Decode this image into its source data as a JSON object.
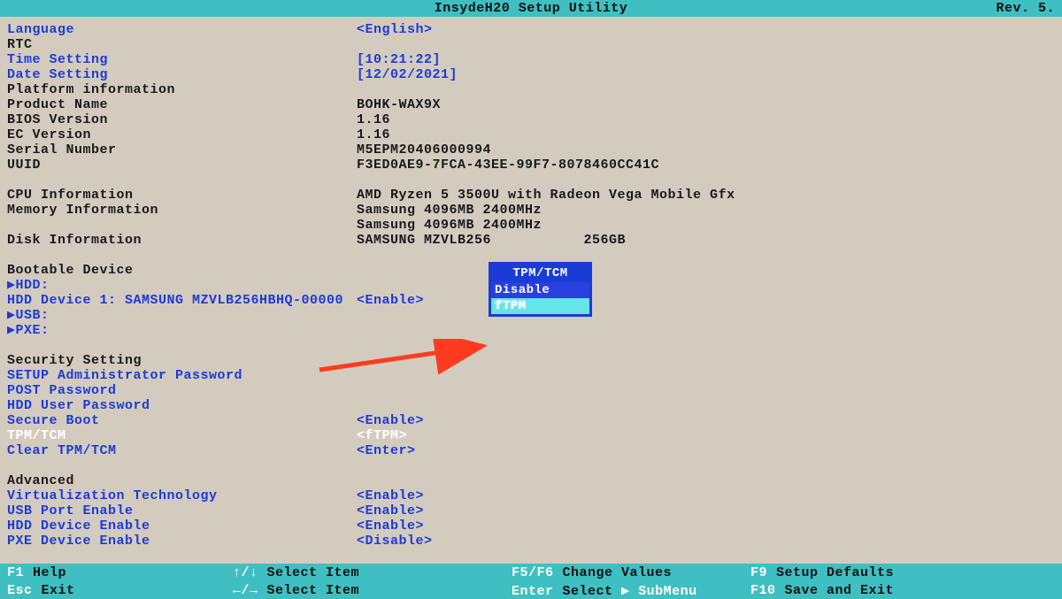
{
  "titlebar": {
    "title": "InsydeH20 Setup Utility",
    "rev": "Rev. 5."
  },
  "rows": {
    "language": {
      "label": "Language",
      "value": "<English>"
    },
    "rtc": {
      "label": "RTC",
      "value": ""
    },
    "time": {
      "label": "Time Setting",
      "value": "[10:21:22]"
    },
    "date": {
      "label": "Date Setting",
      "value": "[12/02/2021]"
    },
    "platform_header": {
      "label": "Platform information",
      "value": ""
    },
    "product": {
      "label": "Product Name",
      "value": "BOHK-WAX9X"
    },
    "bios": {
      "label": "BIOS Version",
      "value": "1.16"
    },
    "ec": {
      "label": "EC Version",
      "value": "1.16"
    },
    "serial": {
      "label": "Serial Number",
      "value": "M5EPM20406000994"
    },
    "uuid": {
      "label": "UUID",
      "value": "F3ED0AE9-7FCA-43EE-99F7-8078460CC41C"
    },
    "cpu": {
      "label": "CPU Information",
      "value": "AMD Ryzen 5 3500U with Radeon Vega Mobile Gfx"
    },
    "mem1": {
      "label": "Memory Information",
      "value": "Samsung 4096MB 2400MHz"
    },
    "mem2": {
      "label": "",
      "value": "Samsung 4096MB 2400MHz"
    },
    "disk": {
      "label": "Disk Information",
      "value": "SAMSUNG MZVLB256           256GB"
    },
    "boot_header": {
      "label": "Bootable Device",
      "value": ""
    },
    "hdd": {
      "label": "▶HDD:",
      "value": ""
    },
    "hdd1": {
      "label": "HDD Device 1: SAMSUNG MZVLB256HBHQ-00000",
      "value": "<Enable>"
    },
    "usb": {
      "label": "▶USB:",
      "value": ""
    },
    "pxe": {
      "label": "▶PXE:",
      "value": ""
    },
    "sec_header": {
      "label": "Security Setting",
      "value": ""
    },
    "setup_pass": {
      "label": "SETUP Administrator Password",
      "value": ""
    },
    "post_pass": {
      "label": "POST Password",
      "value": ""
    },
    "hdd_pass": {
      "label": "HDD User Password",
      "value": ""
    },
    "secure_boot": {
      "label": "Secure Boot",
      "value": "<Enable>"
    },
    "tpm": {
      "label": "TPM/TCM",
      "value": "<fTPM>"
    },
    "clear_tpm": {
      "label": "Clear TPM/TCM",
      "value": "<Enter>"
    },
    "adv_header": {
      "label": "Advanced",
      "value": ""
    },
    "virt": {
      "label": "Virtualization Technology",
      "value": "<Enable>"
    },
    "usb_port": {
      "label": "USB Port Enable",
      "value": "<Enable>"
    },
    "hdd_en": {
      "label": "HDD Device Enable",
      "value": "<Enable>"
    },
    "pxe_en": {
      "label": "PXE Device Enable",
      "value": "<Disable>"
    }
  },
  "popup": {
    "title": "TPM/TCM",
    "options": [
      "Disable",
      "fTPM"
    ],
    "selected": "fTPM"
  },
  "footer": {
    "r1c1k": "F1",
    "r1c1": "Help",
    "r1c2k": "↑/↓",
    "r1c2": "Select Item",
    "r1c3k": "F5/F6",
    "r1c3": "Change Values",
    "r1c4k": "F9",
    "r1c4": "Setup Defaults",
    "r2c1k": "Esc",
    "r2c1": "Exit",
    "r2c2k": "←/→",
    "r2c2": "Select Item",
    "r2c3k": "Enter",
    "r2c3a": "Select",
    "r2c3b": "▶ SubMenu",
    "r2c4k": "F10",
    "r2c4": "Save and Exit"
  }
}
